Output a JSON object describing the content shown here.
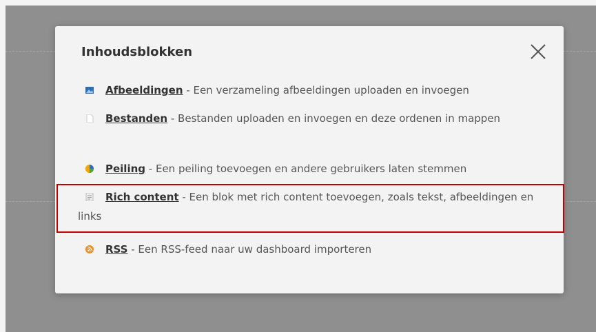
{
  "dialog": {
    "title": "Inhoudsblokken",
    "close_icon": "close-icon",
    "items": [
      {
        "icon": "images-icon",
        "icon_color": "#2b6fb6",
        "label": "Afbeeldingen",
        "description": " - Een verzameling afbeeldingen uploaden en invoegen"
      },
      {
        "icon": "file-icon",
        "icon_color": "#ffffff",
        "label": "Bestanden",
        "description": " - Bestanden uploaden en invoegen en deze ordenen in mappen"
      },
      {
        "icon": "poll-icon",
        "icon_color": "#f0a500",
        "label": "Peiling",
        "description": " - Een peiling toevoegen en andere gebruikers laten stemmen"
      },
      {
        "icon": "rich-content-icon",
        "icon_color": "#e8e8e8",
        "label": "Rich content",
        "description": " - Een blok met rich content toevoegen, zoals tekst, afbeeldingen en links"
      },
      {
        "icon": "rss-icon",
        "icon_color": "#f08a1c",
        "label": "RSS",
        "description": " - Een RSS-feed naar uw dashboard importeren"
      }
    ]
  },
  "highlight_color": "#c00000"
}
